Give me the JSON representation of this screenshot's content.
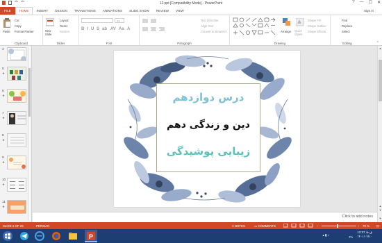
{
  "window": {
    "title": "12.ppt [Compatibility Mode] - PowerPoint",
    "controls": [
      "?",
      "—",
      "☐",
      "✕"
    ],
    "sign_in": "Sign in"
  },
  "tabs": [
    "FILE",
    "HOME",
    "INSERT",
    "DESIGN",
    "TRANSITIONS",
    "ANIMATIONS",
    "SLIDE SHOW",
    "REVIEW",
    "VIEW"
  ],
  "active_tab": "HOME",
  "ribbon": {
    "clipboard": {
      "paste": "Paste",
      "cut": "Cut",
      "copy": "Copy",
      "format_painter": "Format Painter",
      "label": "Clipboard"
    },
    "slides": {
      "new_slide": "New Slide",
      "layout": "Layout",
      "reset": "Reset",
      "section": "Section",
      "label": "Slides"
    },
    "font": {
      "label": "Font",
      "size_value": "24"
    },
    "paragraph": {
      "text_direction": "Text Direction",
      "align_text": "Align Text",
      "smartart": "Convert to SmartArt",
      "label": "Paragraph"
    },
    "drawing": {
      "arrange": "Arrange",
      "quick_styles": "Quick Styles",
      "shape_fill": "Shape Fill",
      "shape_outline": "Shape Outline",
      "shape_effects": "Shape Effects",
      "label": "Drawing"
    },
    "editing": {
      "find": "Find",
      "replace": "Replace",
      "select": "Select",
      "label": "Editing"
    }
  },
  "thumbnails": [
    {
      "num": "4",
      "star": ""
    },
    {
      "num": "5",
      "star": "★"
    },
    {
      "num": "6",
      "star": "★"
    },
    {
      "num": "7",
      "star": "★"
    },
    {
      "num": "8",
      "star": "★"
    },
    {
      "num": "9",
      "star": "★"
    },
    {
      "num": "10",
      "star": "★"
    },
    {
      "num": "11",
      "star": "★"
    }
  ],
  "slide": {
    "line1": "درس دوازدهم",
    "line2": "دین و زندگی دهم",
    "line3": "زیبایی پوشیدگی"
  },
  "notes_hint": "Click to add notes",
  "status": {
    "slide_counter": "SLIDE 2 OF 25",
    "language": "PERSIAN",
    "notes": "NOTES",
    "comments": "COMMENTS",
    "zoom": "70 %"
  },
  "taskbar": {
    "time": "12:37 ق.ظ",
    "date": "۱۴۰۱/۰۷/۱۰",
    "lang": "FA"
  },
  "colors": {
    "accent": "#d24726",
    "taskbar": "#1c3e72",
    "slide_title": "#7ec1d6",
    "slide_subtitle2": "#5cc2b9"
  }
}
